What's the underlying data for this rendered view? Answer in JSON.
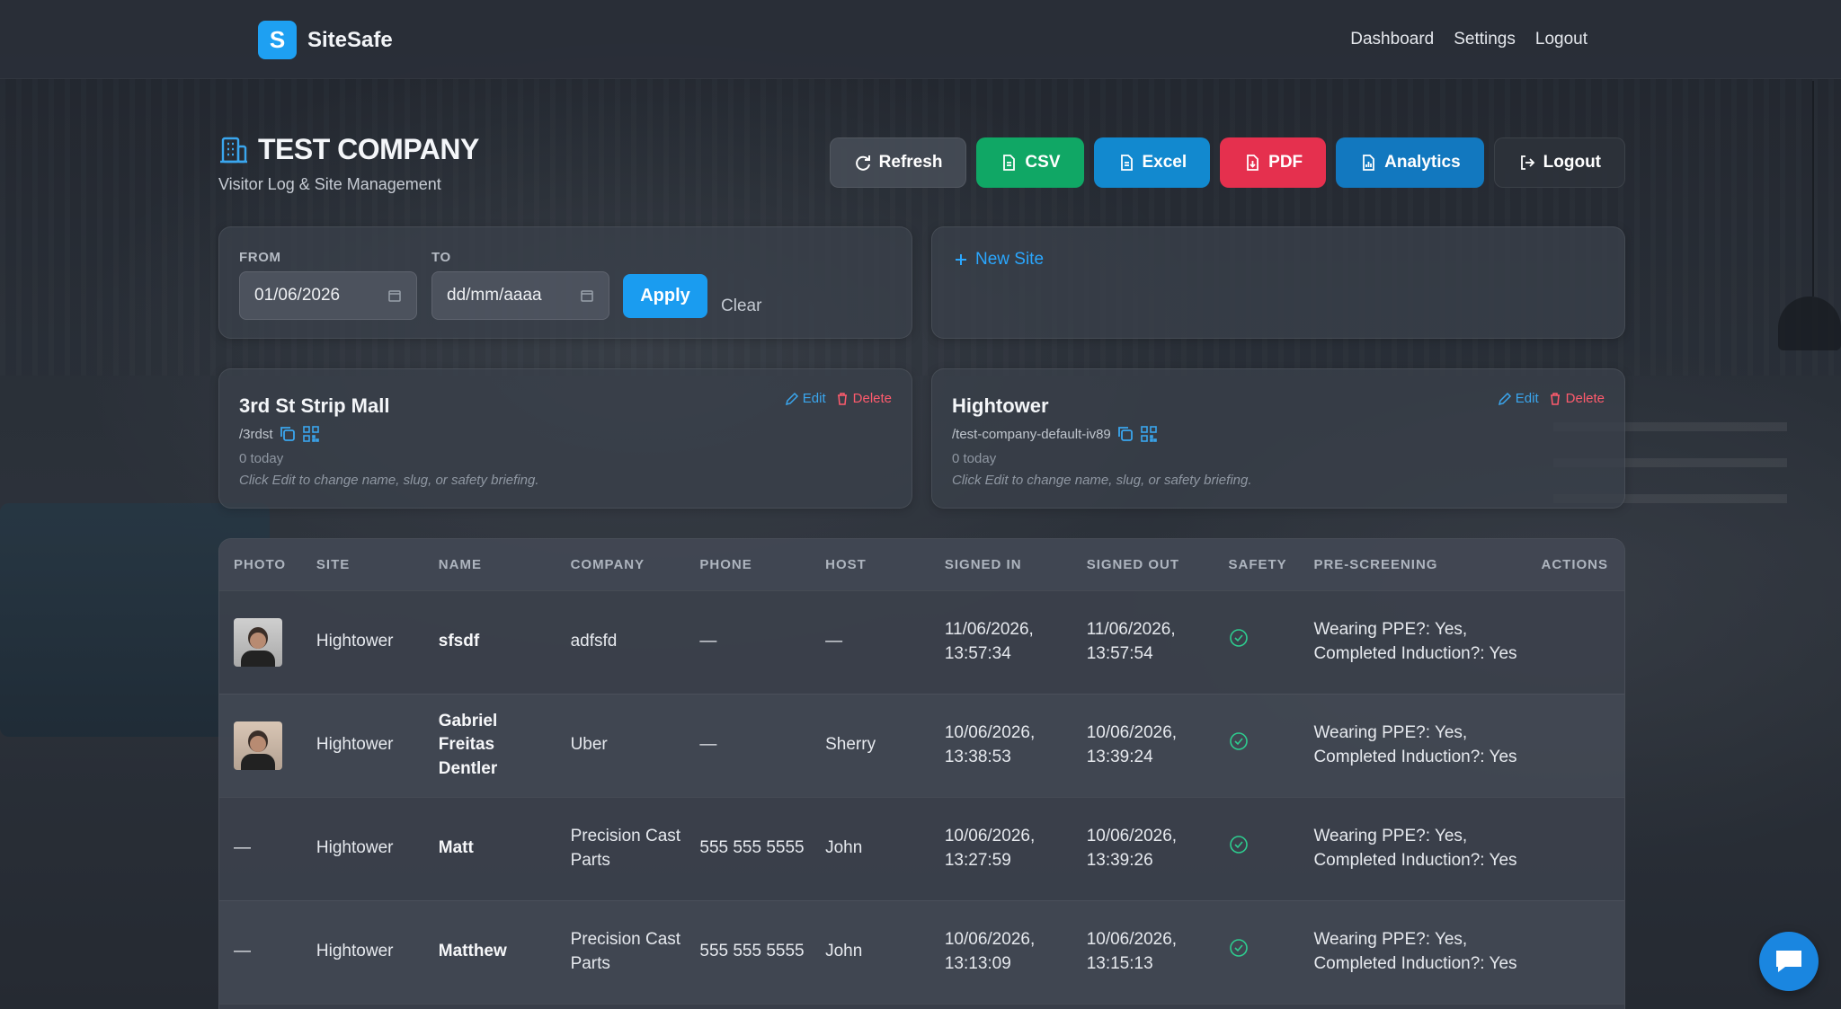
{
  "app": {
    "logo_letter": "S",
    "name": "SiteSafe"
  },
  "nav": {
    "links": [
      "Dashboard",
      "Settings",
      "Logout"
    ]
  },
  "header": {
    "title": "TEST COMPANY",
    "subtitle": "Visitor Log & Site Management"
  },
  "toolbar": {
    "refresh": "Refresh",
    "csv": "CSV",
    "excel": "Excel",
    "pdf": "PDF",
    "analytics": "Analytics",
    "logout": "Logout"
  },
  "filter": {
    "from_label": "FROM",
    "from_value": "01/06/2026",
    "to_label": "TO",
    "to_placeholder": "dd/mm/aaaa",
    "apply": "Apply",
    "clear": "Clear"
  },
  "new_site": {
    "label": "New Site"
  },
  "sites": [
    {
      "name": "3rd St Strip Mall",
      "slug": "/3rdst",
      "count": "0 today",
      "hint": "Click Edit to change name, slug, or safety briefing.",
      "edit": "Edit",
      "delete": "Delete"
    },
    {
      "name": "Hightower",
      "slug": "/test-company-default-iv89",
      "count": "0 today",
      "hint": "Click Edit to change name, slug, or safety briefing.",
      "edit": "Edit",
      "delete": "Delete"
    }
  ],
  "table": {
    "headers": [
      "PHOTO",
      "SITE",
      "NAME",
      "COMPANY",
      "PHONE",
      "HOST",
      "SIGNED IN",
      "SIGNED OUT",
      "SAFETY",
      "PRE-SCREENING",
      "ACTIONS"
    ],
    "rows": [
      {
        "photo": "photo",
        "site": "Hightower",
        "name": "sfsdf",
        "company": "adfsfd",
        "phone": "—",
        "host": "—",
        "signed_in": "11/06/2026, 13:57:34",
        "signed_out": "11/06/2026, 13:57:54",
        "prescreen": "Wearing PPE?: Yes, Completed Induction?: Yes"
      },
      {
        "photo": "photo",
        "site": "Hightower",
        "name": "Gabriel Freitas Dentler",
        "company": "Uber",
        "phone": "—",
        "host": "Sherry",
        "signed_in": "10/06/2026, 13:38:53",
        "signed_out": "10/06/2026, 13:39:24",
        "prescreen": "Wearing PPE?: Yes, Completed Induction?: Yes"
      },
      {
        "photo": "—",
        "site": "Hightower",
        "name": "Matt",
        "company": "Precision Cast Parts",
        "phone": "555 555 5555",
        "host": "John",
        "signed_in": "10/06/2026, 13:27:59",
        "signed_out": "10/06/2026, 13:39:26",
        "prescreen": "Wearing PPE?: Yes, Completed Induction?: Yes"
      },
      {
        "photo": "—",
        "site": "Hightower",
        "name": "Matthew",
        "company": "Precision Cast Parts",
        "phone": "555 555 5555",
        "host": "John",
        "signed_in": "10/06/2026, 13:13:09",
        "signed_out": "10/06/2026, 13:15:13",
        "prescreen": "Wearing PPE?: Yes, Completed Induction?: Yes"
      }
    ]
  },
  "colors": {
    "brand": "#1ea0f2",
    "csv": "#10a765",
    "excel": "#1289cf",
    "pdf": "#e5304e",
    "analytics": "#1278bf",
    "safety_ok": "#2ecc8f",
    "link": "#2aa7ff",
    "danger": "#ff5b6d"
  },
  "icons": {
    "refresh": "refresh-icon",
    "file": "file-icon",
    "pdf": "pdf-icon",
    "chart": "chart-icon",
    "logout": "logout-icon",
    "building": "building-icon",
    "copy": "copy-icon",
    "qr": "qr-code-icon",
    "edit": "pencil-icon",
    "delete": "trash-icon",
    "calendar": "calendar-icon",
    "safety": "check-circle-icon",
    "chat": "chat-icon"
  }
}
